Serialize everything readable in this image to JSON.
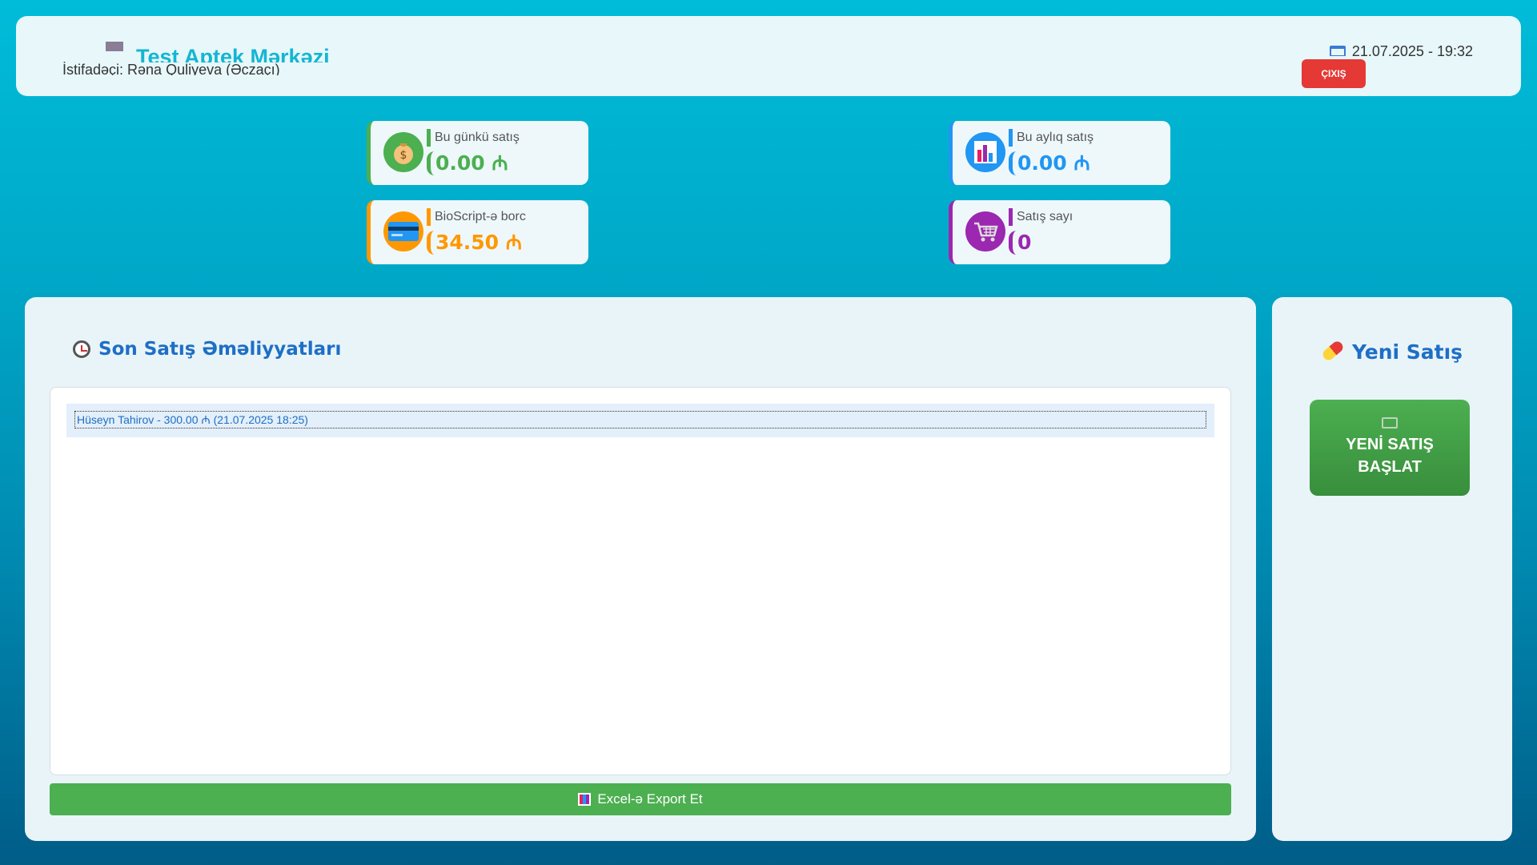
{
  "header": {
    "title": "Test Aptek Mərkəzi",
    "user": "İstifadəçi: Rəna Quliyeva (Əczaçı)",
    "datetime": "21.07.2025 - 19:32",
    "logout_label": "ÇIXIŞ"
  },
  "stats": {
    "today": {
      "label": "Bu günkü satış",
      "value": "0.00 ₼",
      "icon": "money-bag-icon"
    },
    "month": {
      "label": "Bu aylıq satış",
      "value": "0.00 ₼",
      "icon": "bar-chart-icon"
    },
    "debt": {
      "label": "BioScript-ə borc",
      "value": "34.50 ₼",
      "icon": "credit-card-icon"
    },
    "count": {
      "label": "Satış sayı",
      "value": "0",
      "icon": "cart-icon"
    }
  },
  "recent": {
    "title": "Son Satış Əməliyyatları",
    "items": [
      {
        "text": "Hüseyn Tahirov - 300.00 ₼ (21.07.2025 18:25)"
      }
    ],
    "export_label": "Excel-ə Export Et"
  },
  "side": {
    "title": "Yeni Satış",
    "button_label": "YENİ SATIŞ BAŞLAT"
  },
  "colors": {
    "green": "#4caf50",
    "blue": "#2196f3",
    "orange": "#ff9800",
    "purple": "#9c27b0",
    "red": "#e53935",
    "title_blue": "#1e6fc5"
  }
}
